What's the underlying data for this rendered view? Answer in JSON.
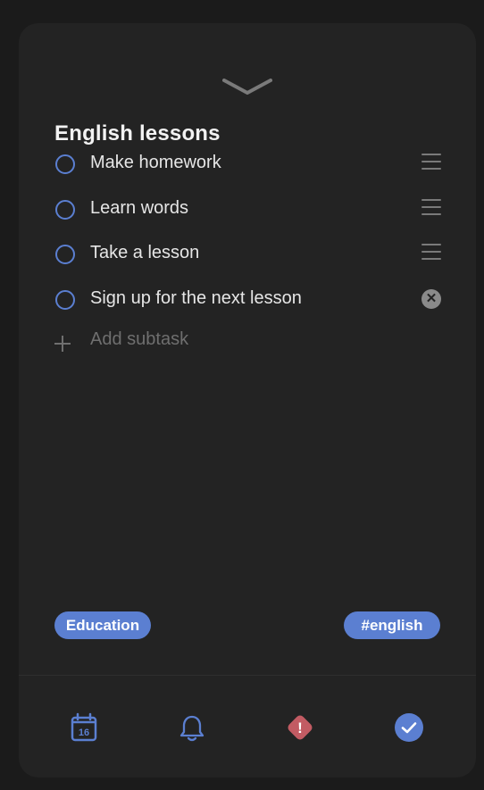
{
  "sheet": {
    "title": "English lessons",
    "subtasks": [
      {
        "label": "Make homework",
        "control": "drag-handle-icon"
      },
      {
        "label": "Learn words",
        "control": "drag-handle-icon"
      },
      {
        "label": "Take a lesson",
        "control": "drag-handle-icon"
      },
      {
        "label": "Sign up for the next lesson",
        "control": "clear-icon",
        "clear_glyph": "✕"
      }
    ],
    "add_subtask_label": "Add subtask",
    "tags": {
      "category": "Education",
      "hashtag": "#english"
    }
  },
  "toolbar": {
    "calendar_day": "16",
    "priority_glyph": "!",
    "icons": [
      "calendar-icon",
      "bell-icon",
      "priority-icon",
      "done-check-icon"
    ]
  },
  "colors": {
    "accent": "#5b7fd1",
    "priority": "#c25b63",
    "background": "#1b1b1b",
    "sheet": "#232323"
  }
}
